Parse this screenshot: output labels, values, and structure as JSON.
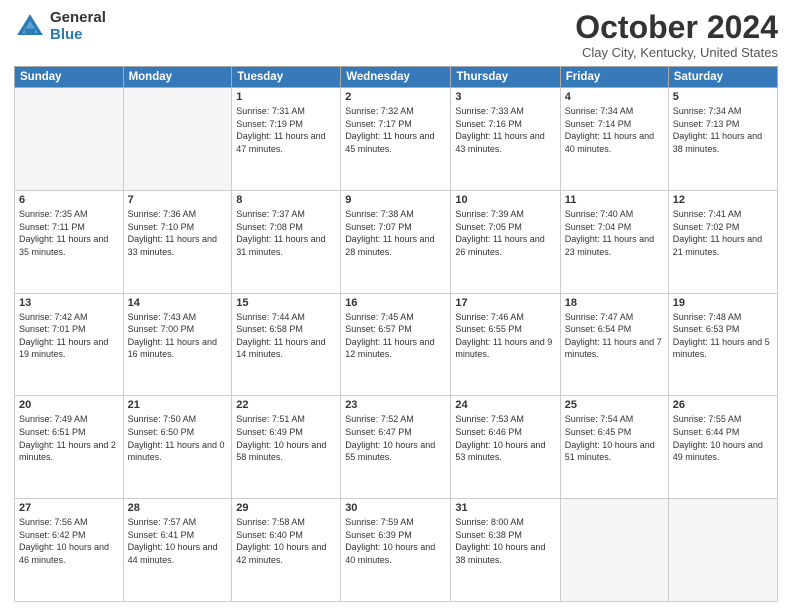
{
  "logo": {
    "general": "General",
    "blue": "Blue"
  },
  "title": {
    "month": "October 2024",
    "location": "Clay City, Kentucky, United States"
  },
  "days_of_week": [
    "Sunday",
    "Monday",
    "Tuesday",
    "Wednesday",
    "Thursday",
    "Friday",
    "Saturday"
  ],
  "weeks": [
    [
      {
        "day": "",
        "info": ""
      },
      {
        "day": "",
        "info": ""
      },
      {
        "day": "1",
        "info": "Sunrise: 7:31 AM\nSunset: 7:19 PM\nDaylight: 11 hours and 47 minutes."
      },
      {
        "day": "2",
        "info": "Sunrise: 7:32 AM\nSunset: 7:17 PM\nDaylight: 11 hours and 45 minutes."
      },
      {
        "day": "3",
        "info": "Sunrise: 7:33 AM\nSunset: 7:16 PM\nDaylight: 11 hours and 43 minutes."
      },
      {
        "day": "4",
        "info": "Sunrise: 7:34 AM\nSunset: 7:14 PM\nDaylight: 11 hours and 40 minutes."
      },
      {
        "day": "5",
        "info": "Sunrise: 7:34 AM\nSunset: 7:13 PM\nDaylight: 11 hours and 38 minutes."
      }
    ],
    [
      {
        "day": "6",
        "info": "Sunrise: 7:35 AM\nSunset: 7:11 PM\nDaylight: 11 hours and 35 minutes."
      },
      {
        "day": "7",
        "info": "Sunrise: 7:36 AM\nSunset: 7:10 PM\nDaylight: 11 hours and 33 minutes."
      },
      {
        "day": "8",
        "info": "Sunrise: 7:37 AM\nSunset: 7:08 PM\nDaylight: 11 hours and 31 minutes."
      },
      {
        "day": "9",
        "info": "Sunrise: 7:38 AM\nSunset: 7:07 PM\nDaylight: 11 hours and 28 minutes."
      },
      {
        "day": "10",
        "info": "Sunrise: 7:39 AM\nSunset: 7:05 PM\nDaylight: 11 hours and 26 minutes."
      },
      {
        "day": "11",
        "info": "Sunrise: 7:40 AM\nSunset: 7:04 PM\nDaylight: 11 hours and 23 minutes."
      },
      {
        "day": "12",
        "info": "Sunrise: 7:41 AM\nSunset: 7:02 PM\nDaylight: 11 hours and 21 minutes."
      }
    ],
    [
      {
        "day": "13",
        "info": "Sunrise: 7:42 AM\nSunset: 7:01 PM\nDaylight: 11 hours and 19 minutes."
      },
      {
        "day": "14",
        "info": "Sunrise: 7:43 AM\nSunset: 7:00 PM\nDaylight: 11 hours and 16 minutes."
      },
      {
        "day": "15",
        "info": "Sunrise: 7:44 AM\nSunset: 6:58 PM\nDaylight: 11 hours and 14 minutes."
      },
      {
        "day": "16",
        "info": "Sunrise: 7:45 AM\nSunset: 6:57 PM\nDaylight: 11 hours and 12 minutes."
      },
      {
        "day": "17",
        "info": "Sunrise: 7:46 AM\nSunset: 6:55 PM\nDaylight: 11 hours and 9 minutes."
      },
      {
        "day": "18",
        "info": "Sunrise: 7:47 AM\nSunset: 6:54 PM\nDaylight: 11 hours and 7 minutes."
      },
      {
        "day": "19",
        "info": "Sunrise: 7:48 AM\nSunset: 6:53 PM\nDaylight: 11 hours and 5 minutes."
      }
    ],
    [
      {
        "day": "20",
        "info": "Sunrise: 7:49 AM\nSunset: 6:51 PM\nDaylight: 11 hours and 2 minutes."
      },
      {
        "day": "21",
        "info": "Sunrise: 7:50 AM\nSunset: 6:50 PM\nDaylight: 11 hours and 0 minutes."
      },
      {
        "day": "22",
        "info": "Sunrise: 7:51 AM\nSunset: 6:49 PM\nDaylight: 10 hours and 58 minutes."
      },
      {
        "day": "23",
        "info": "Sunrise: 7:52 AM\nSunset: 6:47 PM\nDaylight: 10 hours and 55 minutes."
      },
      {
        "day": "24",
        "info": "Sunrise: 7:53 AM\nSunset: 6:46 PM\nDaylight: 10 hours and 53 minutes."
      },
      {
        "day": "25",
        "info": "Sunrise: 7:54 AM\nSunset: 6:45 PM\nDaylight: 10 hours and 51 minutes."
      },
      {
        "day": "26",
        "info": "Sunrise: 7:55 AM\nSunset: 6:44 PM\nDaylight: 10 hours and 49 minutes."
      }
    ],
    [
      {
        "day": "27",
        "info": "Sunrise: 7:56 AM\nSunset: 6:42 PM\nDaylight: 10 hours and 46 minutes."
      },
      {
        "day": "28",
        "info": "Sunrise: 7:57 AM\nSunset: 6:41 PM\nDaylight: 10 hours and 44 minutes."
      },
      {
        "day": "29",
        "info": "Sunrise: 7:58 AM\nSunset: 6:40 PM\nDaylight: 10 hours and 42 minutes."
      },
      {
        "day": "30",
        "info": "Sunrise: 7:59 AM\nSunset: 6:39 PM\nDaylight: 10 hours and 40 minutes."
      },
      {
        "day": "31",
        "info": "Sunrise: 8:00 AM\nSunset: 6:38 PM\nDaylight: 10 hours and 38 minutes."
      },
      {
        "day": "",
        "info": ""
      },
      {
        "day": "",
        "info": ""
      }
    ]
  ]
}
